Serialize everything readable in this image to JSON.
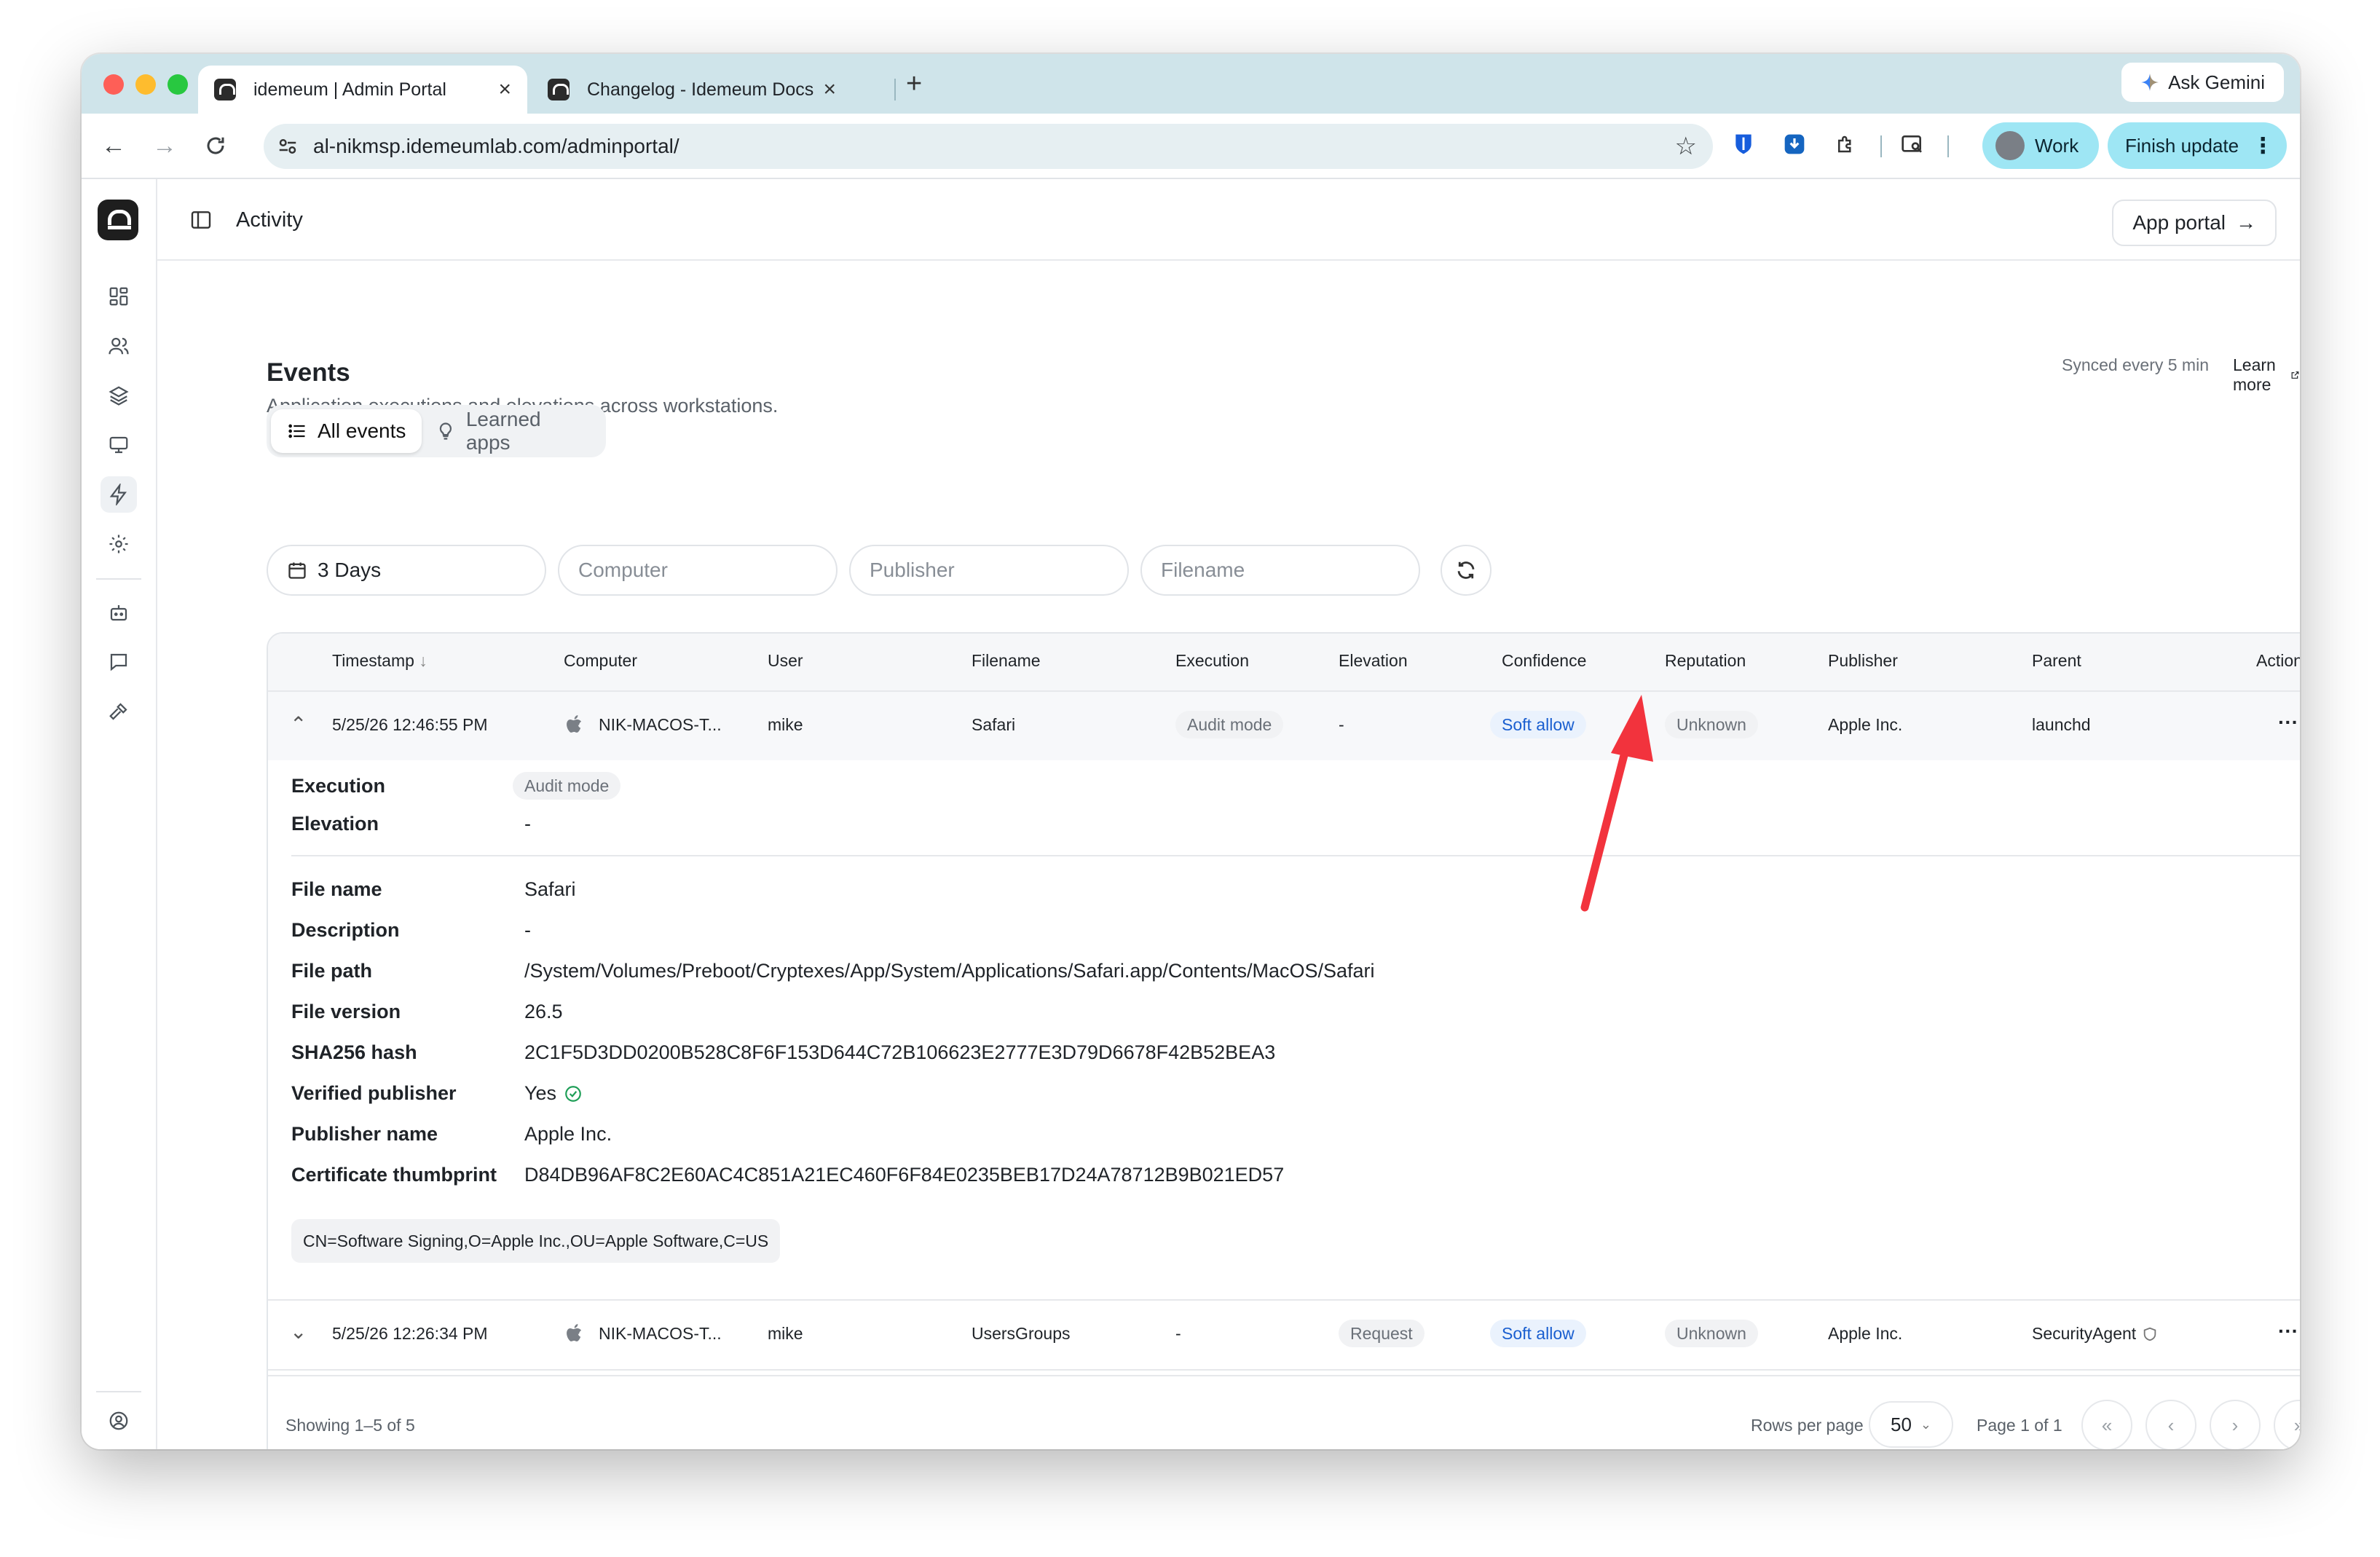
{
  "browser": {
    "tabs": [
      {
        "title": "idemeum | Admin Portal",
        "active": true
      },
      {
        "title": "Changelog - Idemeum Docs",
        "active": false
      }
    ],
    "new_tab": "+",
    "ask_gemini": "Ask Gemini",
    "url": "al-nikmsp.idemeumlab.com/adminportal/",
    "profile_label": "Work",
    "finish_update": "Finish update"
  },
  "header": {
    "title": "Activity",
    "app_portal": "App portal"
  },
  "events": {
    "title": "Events",
    "subtitle": "Application executions and elevations across workstations.",
    "synced": "Synced every 5 min",
    "learn_more": "Learn more"
  },
  "view_tabs": {
    "all_events": "All events",
    "learned_apps": "Learned apps"
  },
  "filters": {
    "range": "3 Days",
    "computer_placeholder": "Computer",
    "publisher_placeholder": "Publisher",
    "filename_placeholder": "Filename"
  },
  "table": {
    "columns": [
      "Timestamp",
      "Computer",
      "User",
      "Filename",
      "Execution",
      "Elevation",
      "Confidence",
      "Reputation",
      "Publisher",
      "Parent",
      "Actions"
    ],
    "rows": [
      {
        "timestamp": "5/25/26 12:46:55 PM",
        "computer": "NIK-MACOS-T...",
        "user": "mike",
        "filename": "Safari",
        "execution": "Audit mode",
        "elevation": "-",
        "confidence": "Soft allow",
        "reputation": "Unknown",
        "publisher": "Apple Inc.",
        "parent": "launchd",
        "actions": "···"
      },
      {
        "timestamp": "5/25/26 12:26:34 PM",
        "computer": "NIK-MACOS-T...",
        "user": "mike",
        "filename": "UsersGroups",
        "execution": "-",
        "elevation": "Request",
        "confidence": "Soft allow",
        "reputation": "Unknown",
        "publisher": "Apple Inc.",
        "parent": "SecurityAgent",
        "actions": "···"
      }
    ]
  },
  "detail": {
    "execution_label": "Execution",
    "execution_value": "Audit mode",
    "elevation_label": "Elevation",
    "elevation_value": "-",
    "file_name_label": "File name",
    "file_name_value": "Safari",
    "description_label": "Description",
    "description_value": "-",
    "file_path_label": "File path",
    "file_path_value": "/System/Volumes/Preboot/Cryptexes/App/System/Applications/Safari.app/Contents/MacOS/Safari",
    "file_version_label": "File version",
    "file_version_value": "26.5",
    "sha256_label": "SHA256 hash",
    "sha256_value": "2C1F5D3DD0200B528C8F6F153D644C72B106623E2777E3D79D6678F42B52BEA3",
    "verified_label": "Verified publisher",
    "verified_value": "Yes",
    "publisher_name_label": "Publisher name",
    "publisher_name_value": "Apple Inc.",
    "thumbprint_label": "Certificate thumbprint",
    "thumbprint_value": "D84DB96AF8C2E60AC4C851A21EC460F6F84E0235BEB17D24A78712B9B021ED57",
    "cert_subject": "CN=Software Signing,O=Apple Inc.,OU=Apple Software,C=US"
  },
  "footer": {
    "showing": "Showing 1–5 of 5",
    "rows_per_page_label": "Rows per page",
    "rows_per_page_value": "50",
    "page_info": "Page 1 of 1"
  },
  "colors": {
    "tabbar": "#cfe4ea",
    "accent_cyan": "#9ee6f4",
    "link_blue": "#1a5fd0",
    "annotation_arrow": "#f2333d",
    "success_green": "#1e9e57"
  }
}
